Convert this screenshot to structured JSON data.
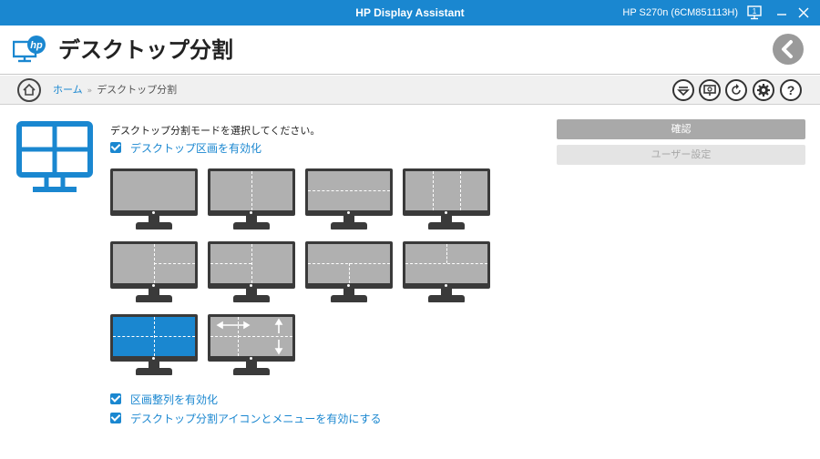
{
  "titlebar": {
    "app_title": "HP Display Assistant",
    "monitor_name": "HP S270n (6CM851113H)",
    "icons": [
      "monitor-number-icon",
      "minimize-icon",
      "close-icon"
    ]
  },
  "header": {
    "title": "デスクトップ分割",
    "logo": "hp-display-logo-icon",
    "back_icon": "back-arrow-icon"
  },
  "breadcrumb": {
    "home": "ホーム",
    "separator": "»",
    "current": "デスクトップ分割"
  },
  "toolbar": {
    "icons": [
      "menu-down-icon",
      "monitor-settings-icon",
      "refresh-icon",
      "gear-icon",
      "help-icon"
    ]
  },
  "main": {
    "instruction": "デスクトップ分割モードを選択してください。",
    "enable_partition_label": "デスクトップ区画を有効化",
    "enable_snap_label": "区画整列を有効化",
    "enable_icon_menu_label": "デスクトップ分割アイコンとメニューを有効にする",
    "layouts": [
      {
        "id": "full",
        "selected": false
      },
      {
        "id": "two-vertical",
        "selected": false
      },
      {
        "id": "two-horizontal",
        "selected": false
      },
      {
        "id": "three-columns",
        "selected": false
      },
      {
        "id": "left-plus-two-right",
        "selected": false
      },
      {
        "id": "two-left-plus-right",
        "selected": false
      },
      {
        "id": "top-plus-two-bottom",
        "selected": false
      },
      {
        "id": "top-left-right-split",
        "selected": false
      },
      {
        "id": "four-quadrants",
        "selected": true
      },
      {
        "id": "custom-resizable",
        "selected": false
      }
    ]
  },
  "actions": {
    "confirm_label": "確認",
    "user_settings_label": "ユーザー設定"
  },
  "colors": {
    "accent": "#1a87d0",
    "monitor_body": "#3a3a3a",
    "screen_idle": "#b0b0b0",
    "button_disabled": "#a9a9a9"
  }
}
